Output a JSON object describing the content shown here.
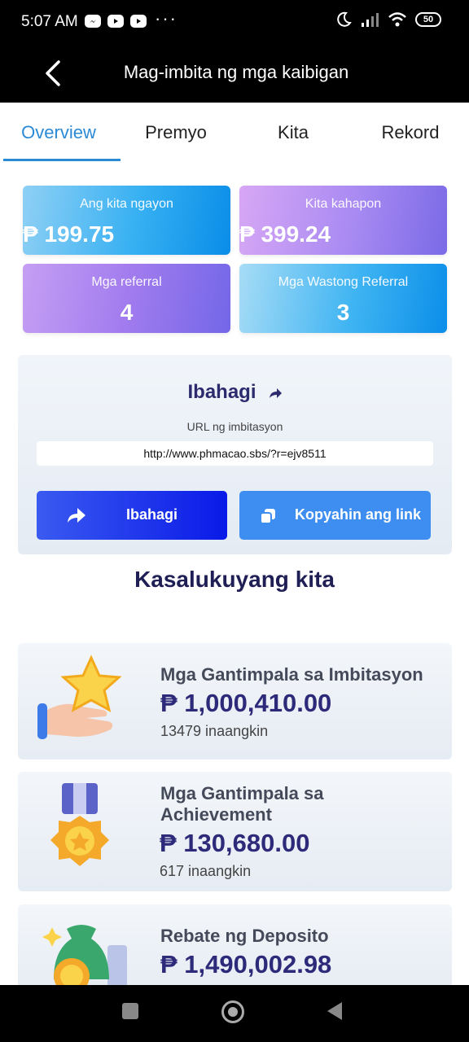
{
  "status_bar": {
    "time": "5:07 AM",
    "notif_icons": [
      "messenger-icon",
      "youtube-icon",
      "youtube-icon"
    ],
    "more": "···",
    "battery": "50"
  },
  "header": {
    "title": "Mag-imbita ng mga kaibigan"
  },
  "tabs": [
    {
      "label": "Overview",
      "active": true
    },
    {
      "label": "Premyo",
      "active": false
    },
    {
      "label": "Kita",
      "active": false
    },
    {
      "label": "Rekord",
      "active": false
    }
  ],
  "stats": {
    "today": {
      "label": "Ang kita ngayon",
      "value": "₱ 199.75"
    },
    "yesterday": {
      "label": "Kita kahapon",
      "value": "₱ 399.24"
    },
    "referrals": {
      "label": "Mga referral",
      "value": "4"
    },
    "valid_referrals": {
      "label": "Mga Wastong Referral",
      "value": "3"
    }
  },
  "share": {
    "title": "Ibahagi",
    "url_caption": "URL ng imbitasyon",
    "url": "http://www.phmacao.sbs/?r=ejv8511",
    "share_button": "Ibahagi",
    "copy_button": "Kopyahin ang link"
  },
  "current_earnings": {
    "title": "Kasalukuyang kita",
    "items": [
      {
        "title": "Mga Gantimpala sa Imbitasyon",
        "amount": "₱ 1,000,410.00",
        "claimed": "13479 inaangkin"
      },
      {
        "title": "Mga Gantimpala sa Achievement",
        "amount": "₱ 130,680.00",
        "claimed": "617 inaangkin"
      },
      {
        "title": "Rebate ng Deposito",
        "amount": "₱ 1,490,002.98",
        "claimed": ""
      }
    ]
  },
  "colors": {
    "accent": "#2a8ad6",
    "dark_text": "#2d2a7a"
  }
}
